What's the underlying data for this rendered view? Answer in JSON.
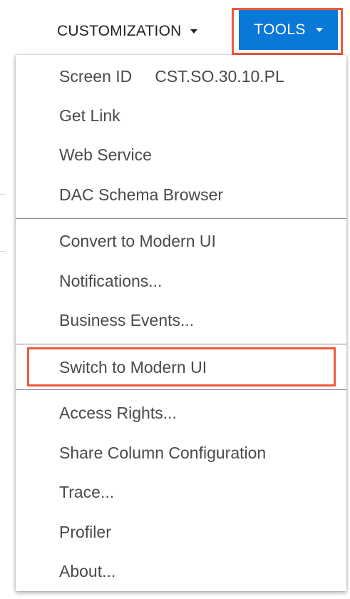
{
  "toolbar": {
    "customization_label": "CUSTOMIZATION",
    "tools_label": "TOOLS"
  },
  "menu": {
    "screen_id_label": "Screen ID",
    "screen_id_value": "CST.SO.30.10.PL",
    "get_link": "Get Link",
    "web_service": "Web Service",
    "dac_schema_browser": "DAC Schema Browser",
    "convert_to_modern_ui": "Convert to Modern UI",
    "notifications": "Notifications...",
    "business_events": "Business Events...",
    "switch_to_modern_ui": "Switch to Modern UI",
    "access_rights": "Access Rights...",
    "share_column_configuration": "Share Column Configuration",
    "trace": "Trace...",
    "profiler": "Profiler",
    "about": "About..."
  },
  "colors": {
    "tools_background": "#0a78d7",
    "highlight_border": "#ee5a3c",
    "menu_text": "#4a4a4a"
  }
}
